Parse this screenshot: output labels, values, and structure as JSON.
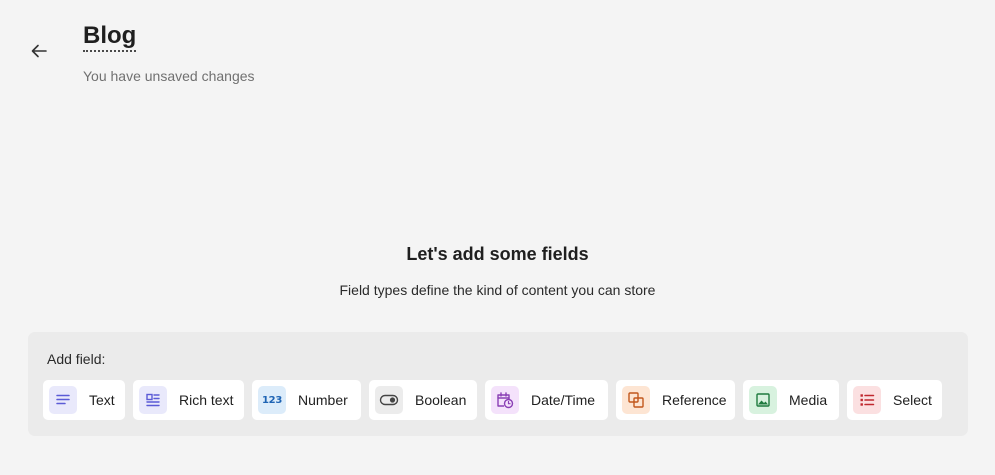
{
  "header": {
    "title": "Blog",
    "status": "You have unsaved changes"
  },
  "empty_state": {
    "title": "Let's add some fields",
    "description": "Field types define the kind of content you can store"
  },
  "add_field": {
    "label": "Add field:",
    "types": [
      {
        "label": "Text",
        "icon": "text-lines-icon",
        "color": "#5b5bd6",
        "bg": "#e9e9fb"
      },
      {
        "label": "Rich text",
        "icon": "rich-text-icon",
        "color": "#5b5bd6",
        "bg": "#e9e9fb"
      },
      {
        "label": "Number",
        "icon": "number-icon",
        "icon_text": "123",
        "color": "#1e64b4",
        "bg": "#dcecfa"
      },
      {
        "label": "Boolean",
        "icon": "toggle-icon",
        "color": "#444444",
        "bg": "#ececec"
      },
      {
        "label": "Date/Time",
        "icon": "calendar-clock-icon",
        "color": "#8a3fb5",
        "bg": "#f4e2fb"
      },
      {
        "label": "Reference",
        "icon": "reference-icon",
        "color": "#c2571c",
        "bg": "#fde5d3"
      },
      {
        "label": "Media",
        "icon": "image-icon",
        "color": "#1e7a3e",
        "bg": "#d8f2df"
      },
      {
        "label": "Select",
        "icon": "list-icon",
        "color": "#c0282f",
        "bg": "#fbe0e1"
      }
    ]
  }
}
